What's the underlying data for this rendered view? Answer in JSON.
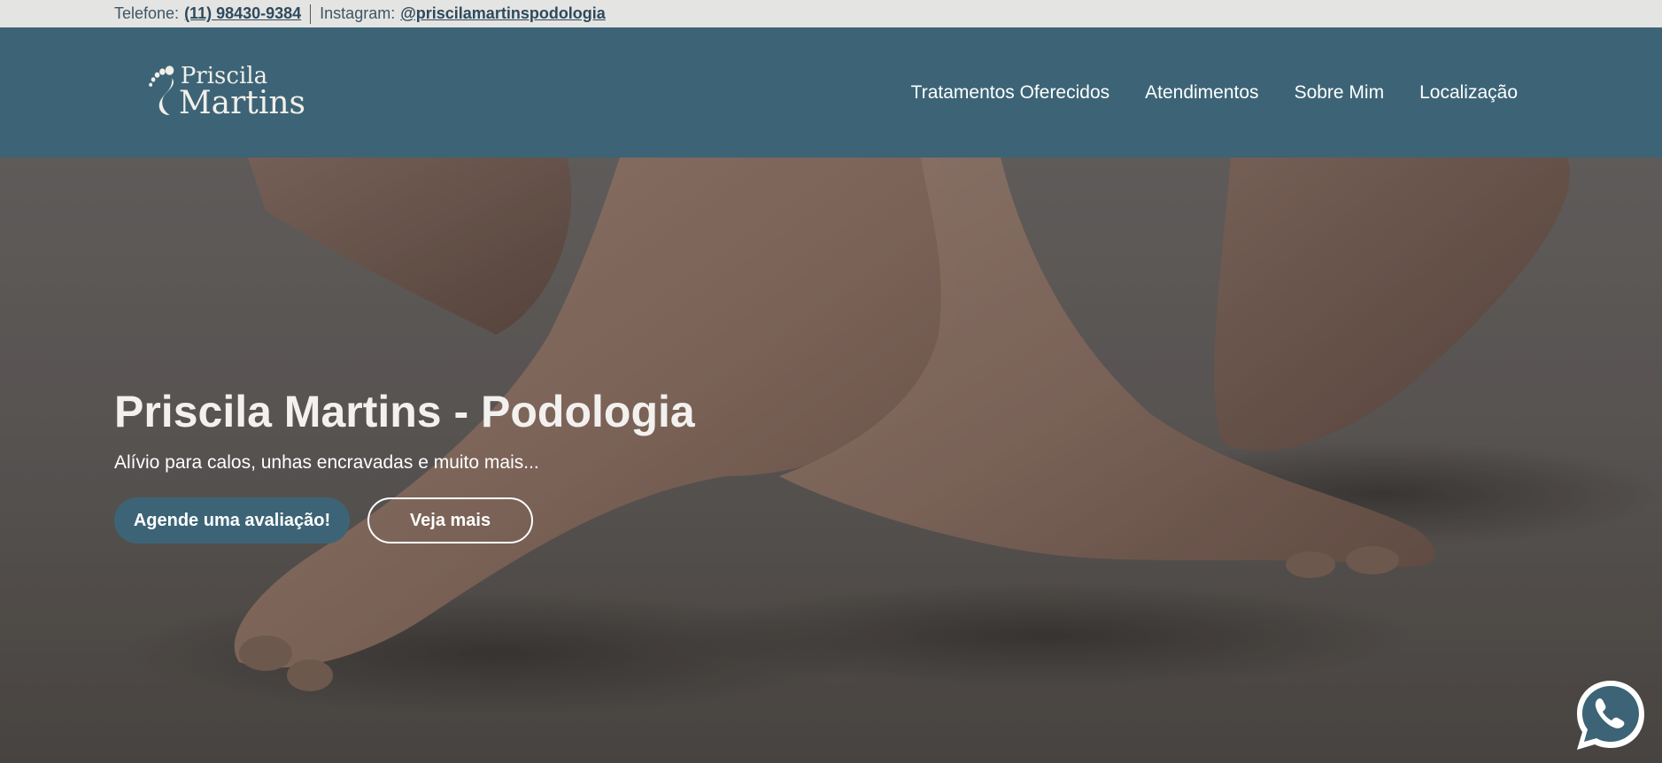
{
  "topbar": {
    "phone_label": "Telefone:",
    "phone_value": "(11) 98430-9384",
    "instagram_label": "Instagram:",
    "instagram_value": "@priscilamartinspodologia"
  },
  "logo": {
    "line1": "Priscila",
    "line2": "Martins"
  },
  "nav": {
    "items": [
      "Tratamentos Oferecidos",
      "Atendimentos",
      "Sobre Mim",
      "Localização"
    ]
  },
  "hero": {
    "title": "Priscila Martins - Podologia",
    "subtitle": "Alívio para calos, unhas encravadas e muito mais...",
    "primary_button": "Agende uma avaliação!",
    "secondary_button": "Veja mais"
  },
  "colors": {
    "brand": "#3c6476",
    "topbar_bg": "#e4e4e3",
    "whatsapp_icon": "whatsapp-icon"
  }
}
